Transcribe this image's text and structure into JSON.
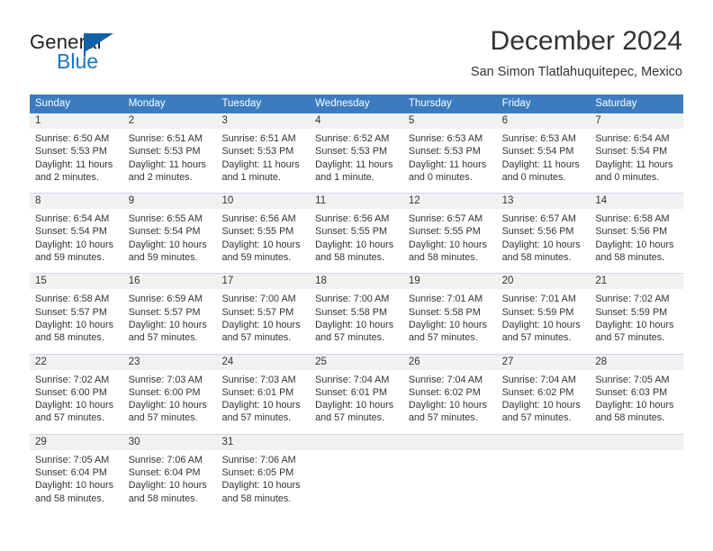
{
  "brand": {
    "name_dark": "General",
    "name_blue": "Blue",
    "flag_color": "#1461a8",
    "blue_color": "#1b75bb"
  },
  "header": {
    "title": "December 2024",
    "subtitle": "San Simon Tlatlahuquitepec, Mexico"
  },
  "theme": {
    "header_blue": "#3b7cc0",
    "day_band_gray": "#f1f1f1",
    "row_divider": "#c9d8e8",
    "text": "#333333"
  },
  "weekdays": [
    "Sunday",
    "Monday",
    "Tuesday",
    "Wednesday",
    "Thursday",
    "Friday",
    "Saturday"
  ],
  "weeks": [
    [
      {
        "day": "1",
        "sunrise": "Sunrise: 6:50 AM",
        "sunset": "Sunset: 5:53 PM",
        "daylight1": "Daylight: 11 hours",
        "daylight2": "and 2 minutes."
      },
      {
        "day": "2",
        "sunrise": "Sunrise: 6:51 AM",
        "sunset": "Sunset: 5:53 PM",
        "daylight1": "Daylight: 11 hours",
        "daylight2": "and 2 minutes."
      },
      {
        "day": "3",
        "sunrise": "Sunrise: 6:51 AM",
        "sunset": "Sunset: 5:53 PM",
        "daylight1": "Daylight: 11 hours",
        "daylight2": "and 1 minute."
      },
      {
        "day": "4",
        "sunrise": "Sunrise: 6:52 AM",
        "sunset": "Sunset: 5:53 PM",
        "daylight1": "Daylight: 11 hours",
        "daylight2": "and 1 minute."
      },
      {
        "day": "5",
        "sunrise": "Sunrise: 6:53 AM",
        "sunset": "Sunset: 5:53 PM",
        "daylight1": "Daylight: 11 hours",
        "daylight2": "and 0 minutes."
      },
      {
        "day": "6",
        "sunrise": "Sunrise: 6:53 AM",
        "sunset": "Sunset: 5:54 PM",
        "daylight1": "Daylight: 11 hours",
        "daylight2": "and 0 minutes."
      },
      {
        "day": "7",
        "sunrise": "Sunrise: 6:54 AM",
        "sunset": "Sunset: 5:54 PM",
        "daylight1": "Daylight: 11 hours",
        "daylight2": "and 0 minutes."
      }
    ],
    [
      {
        "day": "8",
        "sunrise": "Sunrise: 6:54 AM",
        "sunset": "Sunset: 5:54 PM",
        "daylight1": "Daylight: 10 hours",
        "daylight2": "and 59 minutes."
      },
      {
        "day": "9",
        "sunrise": "Sunrise: 6:55 AM",
        "sunset": "Sunset: 5:54 PM",
        "daylight1": "Daylight: 10 hours",
        "daylight2": "and 59 minutes."
      },
      {
        "day": "10",
        "sunrise": "Sunrise: 6:56 AM",
        "sunset": "Sunset: 5:55 PM",
        "daylight1": "Daylight: 10 hours",
        "daylight2": "and 59 minutes."
      },
      {
        "day": "11",
        "sunrise": "Sunrise: 6:56 AM",
        "sunset": "Sunset: 5:55 PM",
        "daylight1": "Daylight: 10 hours",
        "daylight2": "and 58 minutes."
      },
      {
        "day": "12",
        "sunrise": "Sunrise: 6:57 AM",
        "sunset": "Sunset: 5:55 PM",
        "daylight1": "Daylight: 10 hours",
        "daylight2": "and 58 minutes."
      },
      {
        "day": "13",
        "sunrise": "Sunrise: 6:57 AM",
        "sunset": "Sunset: 5:56 PM",
        "daylight1": "Daylight: 10 hours",
        "daylight2": "and 58 minutes."
      },
      {
        "day": "14",
        "sunrise": "Sunrise: 6:58 AM",
        "sunset": "Sunset: 5:56 PM",
        "daylight1": "Daylight: 10 hours",
        "daylight2": "and 58 minutes."
      }
    ],
    [
      {
        "day": "15",
        "sunrise": "Sunrise: 6:58 AM",
        "sunset": "Sunset: 5:57 PM",
        "daylight1": "Daylight: 10 hours",
        "daylight2": "and 58 minutes."
      },
      {
        "day": "16",
        "sunrise": "Sunrise: 6:59 AM",
        "sunset": "Sunset: 5:57 PM",
        "daylight1": "Daylight: 10 hours",
        "daylight2": "and 57 minutes."
      },
      {
        "day": "17",
        "sunrise": "Sunrise: 7:00 AM",
        "sunset": "Sunset: 5:57 PM",
        "daylight1": "Daylight: 10 hours",
        "daylight2": "and 57 minutes."
      },
      {
        "day": "18",
        "sunrise": "Sunrise: 7:00 AM",
        "sunset": "Sunset: 5:58 PM",
        "daylight1": "Daylight: 10 hours",
        "daylight2": "and 57 minutes."
      },
      {
        "day": "19",
        "sunrise": "Sunrise: 7:01 AM",
        "sunset": "Sunset: 5:58 PM",
        "daylight1": "Daylight: 10 hours",
        "daylight2": "and 57 minutes."
      },
      {
        "day": "20",
        "sunrise": "Sunrise: 7:01 AM",
        "sunset": "Sunset: 5:59 PM",
        "daylight1": "Daylight: 10 hours",
        "daylight2": "and 57 minutes."
      },
      {
        "day": "21",
        "sunrise": "Sunrise: 7:02 AM",
        "sunset": "Sunset: 5:59 PM",
        "daylight1": "Daylight: 10 hours",
        "daylight2": "and 57 minutes."
      }
    ],
    [
      {
        "day": "22",
        "sunrise": "Sunrise: 7:02 AM",
        "sunset": "Sunset: 6:00 PM",
        "daylight1": "Daylight: 10 hours",
        "daylight2": "and 57 minutes."
      },
      {
        "day": "23",
        "sunrise": "Sunrise: 7:03 AM",
        "sunset": "Sunset: 6:00 PM",
        "daylight1": "Daylight: 10 hours",
        "daylight2": "and 57 minutes."
      },
      {
        "day": "24",
        "sunrise": "Sunrise: 7:03 AM",
        "sunset": "Sunset: 6:01 PM",
        "daylight1": "Daylight: 10 hours",
        "daylight2": "and 57 minutes."
      },
      {
        "day": "25",
        "sunrise": "Sunrise: 7:04 AM",
        "sunset": "Sunset: 6:01 PM",
        "daylight1": "Daylight: 10 hours",
        "daylight2": "and 57 minutes."
      },
      {
        "day": "26",
        "sunrise": "Sunrise: 7:04 AM",
        "sunset": "Sunset: 6:02 PM",
        "daylight1": "Daylight: 10 hours",
        "daylight2": "and 57 minutes."
      },
      {
        "day": "27",
        "sunrise": "Sunrise: 7:04 AM",
        "sunset": "Sunset: 6:02 PM",
        "daylight1": "Daylight: 10 hours",
        "daylight2": "and 57 minutes."
      },
      {
        "day": "28",
        "sunrise": "Sunrise: 7:05 AM",
        "sunset": "Sunset: 6:03 PM",
        "daylight1": "Daylight: 10 hours",
        "daylight2": "and 58 minutes."
      }
    ],
    [
      {
        "day": "29",
        "sunrise": "Sunrise: 7:05 AM",
        "sunset": "Sunset: 6:04 PM",
        "daylight1": "Daylight: 10 hours",
        "daylight2": "and 58 minutes."
      },
      {
        "day": "30",
        "sunrise": "Sunrise: 7:06 AM",
        "sunset": "Sunset: 6:04 PM",
        "daylight1": "Daylight: 10 hours",
        "daylight2": "and 58 minutes."
      },
      {
        "day": "31",
        "sunrise": "Sunrise: 7:06 AM",
        "sunset": "Sunset: 6:05 PM",
        "daylight1": "Daylight: 10 hours",
        "daylight2": "and 58 minutes."
      },
      {
        "day": "",
        "sunrise": "",
        "sunset": "",
        "daylight1": "",
        "daylight2": ""
      },
      {
        "day": "",
        "sunrise": "",
        "sunset": "",
        "daylight1": "",
        "daylight2": ""
      },
      {
        "day": "",
        "sunrise": "",
        "sunset": "",
        "daylight1": "",
        "daylight2": ""
      },
      {
        "day": "",
        "sunrise": "",
        "sunset": "",
        "daylight1": "",
        "daylight2": ""
      }
    ]
  ]
}
